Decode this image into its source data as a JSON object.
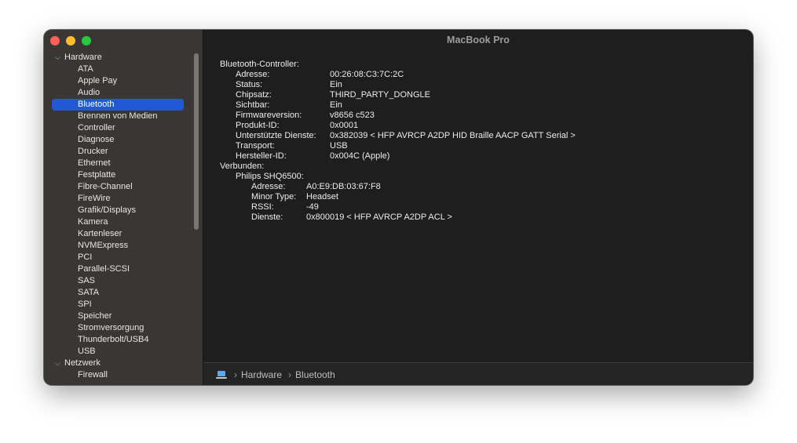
{
  "window": {
    "title": "MacBook Pro"
  },
  "sidebar": {
    "groups": [
      {
        "label": "Hardware",
        "items": [
          "ATA",
          "Apple Pay",
          "Audio",
          "Bluetooth",
          "Brennen von Medien",
          "Controller",
          "Diagnose",
          "Drucker",
          "Ethernet",
          "Festplatte",
          "Fibre-Channel",
          "FireWire",
          "Grafik/Displays",
          "Kamera",
          "Kartenleser",
          "NVMExpress",
          "PCI",
          "Parallel-SCSI",
          "SAS",
          "SATA",
          "SPI",
          "Speicher",
          "Stromversorgung",
          "Thunderbolt/USB4",
          "USB"
        ]
      },
      {
        "label": "Netzwerk",
        "items": [
          "Firewall"
        ]
      }
    ],
    "selected_item": "Bluetooth"
  },
  "details": {
    "controller_header": "Bluetooth-Controller:",
    "controller_rows": [
      {
        "label": "Adresse:",
        "value": "00:26:08:C3:7C:2C"
      },
      {
        "label": "Status:",
        "value": "Ein"
      },
      {
        "label": "Chipsatz:",
        "value": "THIRD_PARTY_DONGLE"
      },
      {
        "label": "Sichtbar:",
        "value": "Ein"
      },
      {
        "label": "Firmwareversion:",
        "value": "v8656 c523"
      },
      {
        "label": "Produkt-ID:",
        "value": "0x0001"
      },
      {
        "label": "Unterstützte Dienste:",
        "value": "0x382039 < HFP AVRCP A2DP HID Braille AACP GATT Serial >"
      },
      {
        "label": "Transport:",
        "value": "USB"
      },
      {
        "label": "Hersteller-ID:",
        "value": "0x004C (Apple)"
      }
    ],
    "connected_header": "Verbunden:",
    "device_name": "Philips SHQ6500:",
    "device_rows": [
      {
        "label": "Adresse:",
        "value": "A0:E9:DB:03:67:F8"
      },
      {
        "label": "Minor Type:",
        "value": "Headset"
      },
      {
        "label": "RSSI:",
        "value": "-49"
      },
      {
        "label": "Dienste:",
        "value": "0x800019 < HFP AVRCP A2DP ACL >"
      }
    ]
  },
  "breadcrumb": {
    "icon": "laptop-icon",
    "parts": [
      "Hardware",
      "Bluetooth"
    ],
    "separator": "›"
  },
  "colors": {
    "selection": "#2158d6",
    "sidebar_bg": "#3a3633",
    "content_bg": "#1e1e1e"
  }
}
